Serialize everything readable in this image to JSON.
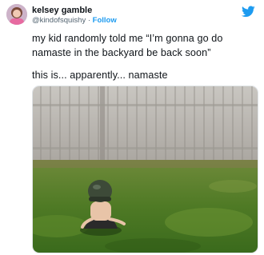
{
  "author": {
    "display_name": "kelsey gamble",
    "handle": "@kindofsquishy",
    "separator": "·",
    "follow_label": "Follow",
    "avatar_icon": "user-avatar",
    "platform_icon": "twitter-bird-icon"
  },
  "tweet": {
    "lines": [
      "my kid randomly told me “I’m gonna go do",
      "namaste in the backyard be back soon”",
      "this is... apparently... namaste"
    ]
  },
  "colors": {
    "link": "#1d9bf0",
    "secondary_text": "#536471",
    "primary_text": "#0f1419"
  }
}
